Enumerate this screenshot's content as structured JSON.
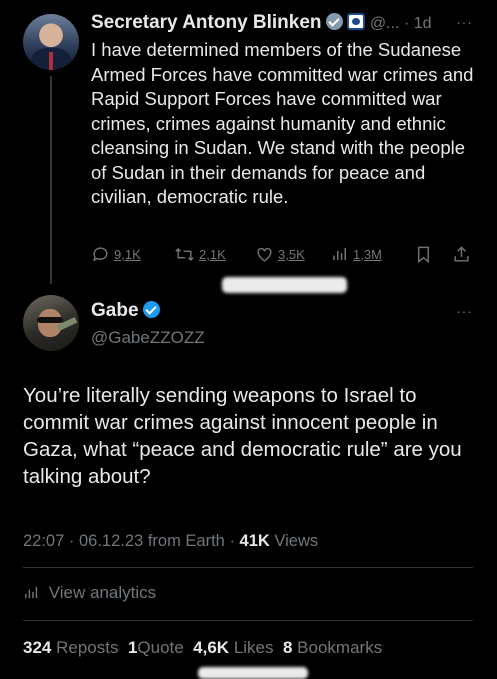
{
  "tweet": {
    "author_name": "Secretary Antony Blinken",
    "handle": "@...",
    "dot": "·",
    "age": "1d",
    "text": "I have determined members of the Sudanese Armed Forces have committed war crimes and Rapid Support Forces have committed war crimes, crimes against humanity and ethnic cleansing in Sudan. We stand with the people of Sudan in their demands for peace and civilian, democratic rule.",
    "replies": "9,1K",
    "reposts": "2,1K",
    "likes": "3,5K",
    "views": "1,3M"
  },
  "reply": {
    "author_name": "Gabe",
    "handle": "@GabeZZOZZ",
    "text": "You’re literally sending weapons to Israel to commit war crimes against innocent people in Gaza, what “peace and democratic rule” are you talking about?",
    "time": "22:07",
    "sep": "·",
    "date": "06.12.23",
    "location": "from Earth",
    "view_count": "41K",
    "views_label": "Views",
    "analytics_label": "View analytics",
    "reposts_count": "324",
    "reposts_label": "Reposts",
    "quotes_count": "1",
    "quotes_label": "Quote",
    "likes_count": "4,6K",
    "likes_label": "Likes",
    "bookmarks_count": "8",
    "bookmarks_label": "Bookmarks"
  },
  "more_label": "···",
  "colors": {
    "accent": "#1d9bf0",
    "muted": "#71767b",
    "background": "#000000"
  }
}
